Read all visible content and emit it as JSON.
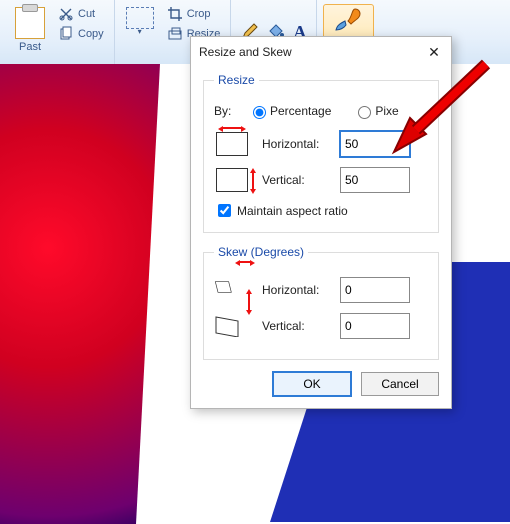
{
  "ribbon": {
    "paste_label": "Past",
    "cut_label": "Cut",
    "copy_label": "Copy",
    "select_label": "",
    "crop_label": "Crop",
    "resize_label": "Resize",
    "brushes_label": "Brushes"
  },
  "dialog": {
    "title": "Resize and Skew",
    "resize": {
      "legend": "Resize",
      "by_label": "By:",
      "percentage_label": "Percentage",
      "pixels_label": "Pixe",
      "horizontal_label": "Horizontal:",
      "vertical_label": "Vertical:",
      "horizontal_value": "50",
      "vertical_value": "50",
      "aspect_label": "Maintain aspect ratio",
      "aspect_checked": true,
      "mode": "percentage"
    },
    "skew": {
      "legend": "Skew (Degrees)",
      "horizontal_label": "Horizontal:",
      "vertical_label": "Vertical:",
      "horizontal_value": "0",
      "vertical_value": "0"
    },
    "ok_label": "OK",
    "cancel_label": "Cancel"
  }
}
